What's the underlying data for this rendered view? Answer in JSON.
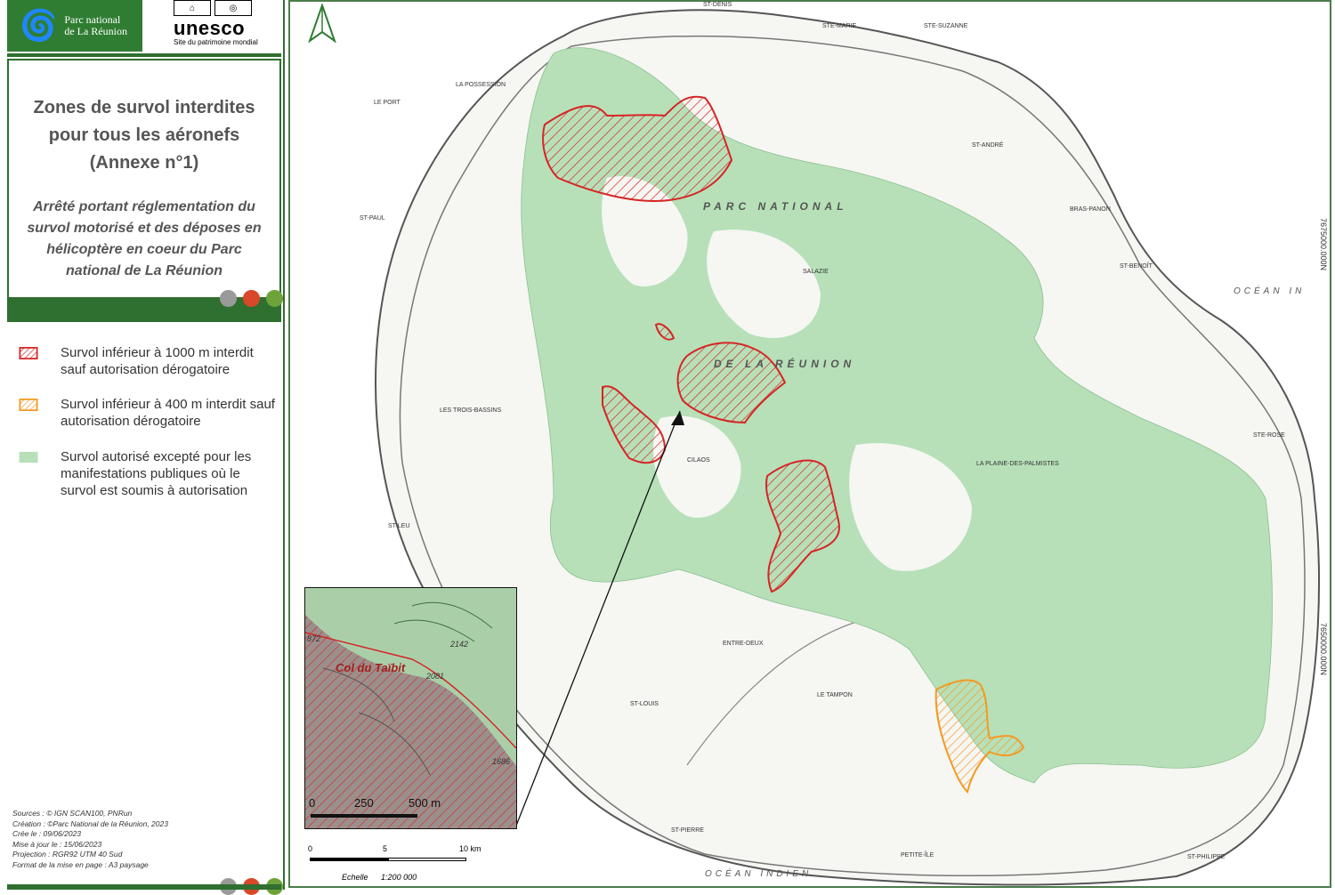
{
  "logos": {
    "parc_line1": "Parc national",
    "parc_line2": "de La Réunion",
    "unesco_word": "unesco",
    "unesco_sub": "Site du patrimoine mondial"
  },
  "title": {
    "main": "Zones de survol interdites pour tous les aéronefs (Annexe n°1)",
    "subtitle": "Arrêté portant réglementation du survol motorisé et des déposes en hélicoptère en coeur du Parc national de La Réunion"
  },
  "colors": {
    "dark_green": "#2f6f2f",
    "park_green": "#b7e0b8",
    "red_zone": "#d62525",
    "orange_zone": "#f39a22",
    "dot_grey": "#9a9a9a",
    "dot_red": "#d9482b",
    "dot_green": "#6da33a"
  },
  "legend": {
    "items": [
      {
        "label": "Survol inférieur à 1000 m interdit sauf autorisation dérogatoire",
        "swatch": "red-hatch-swatch"
      },
      {
        "label": "Survol inférieur à 400 m interdit sauf autorisation dérogatoire",
        "swatch": "orange-hatch-swatch"
      },
      {
        "label": "Survol autorisé excepté pour les manifestations publiques où le survol est soumis à autorisation",
        "swatch": "green-fill-swatch"
      }
    ]
  },
  "sources": {
    "line1": "Sources : © IGN SCAN100, PNRun",
    "line2": "Création : ©Parc National de la Réunion, 2023",
    "line3": "Crée le : 09/06/2023",
    "line4": "Mise à jour le : 15/06/2023",
    "line5": "Projection : RGR92 UTM 40 Sud",
    "line6": "Format de la mise en page : A3 paysage"
  },
  "map": {
    "park_label_1": "PARC NATIONAL",
    "park_label_2": "DE LA RÉUNION",
    "ocean_east": "OCÉAN IN",
    "ocean_south": "OCÉAN INDIEN",
    "coord_north": "7675000.000N",
    "coord_south": "7650000.000N",
    "places": [
      {
        "name": "ST-DENIS"
      },
      {
        "name": "STE-MARIE"
      },
      {
        "name": "STE-SUZANNE"
      },
      {
        "name": "LA POSSESSION"
      },
      {
        "name": "LE PORT"
      },
      {
        "name": "ST-PAUL"
      },
      {
        "name": "ST-ANDRÉ"
      },
      {
        "name": "BRAS-PANON"
      },
      {
        "name": "ST-BENOÎT"
      },
      {
        "name": "SALAZIE"
      },
      {
        "name": "STE-ROSE"
      },
      {
        "name": "LA PLAINE-DES-PALMISTES"
      },
      {
        "name": "LES TROIS-BASSINS"
      },
      {
        "name": "CILAOS"
      },
      {
        "name": "ST-LEU"
      },
      {
        "name": "ENTRE-DEUX"
      },
      {
        "name": "LE TAMPON"
      },
      {
        "name": "ST-LOUIS"
      },
      {
        "name": "ST-PIERRE"
      },
      {
        "name": "PETITE-ÎLE"
      },
      {
        "name": "ST-PHILIPPE"
      }
    ]
  },
  "inset": {
    "label": "Col du Taïbit",
    "elev1": "872",
    "elev2": "2142",
    "elev3": "2081",
    "elev4": "1686"
  },
  "scale": {
    "ticks": [
      "0",
      "5",
      "10 km"
    ],
    "echelle": "Echelle",
    "ratio": "1:200 000"
  },
  "inset_scale": {
    "ticks": [
      "0",
      "250",
      "500 m"
    ]
  }
}
